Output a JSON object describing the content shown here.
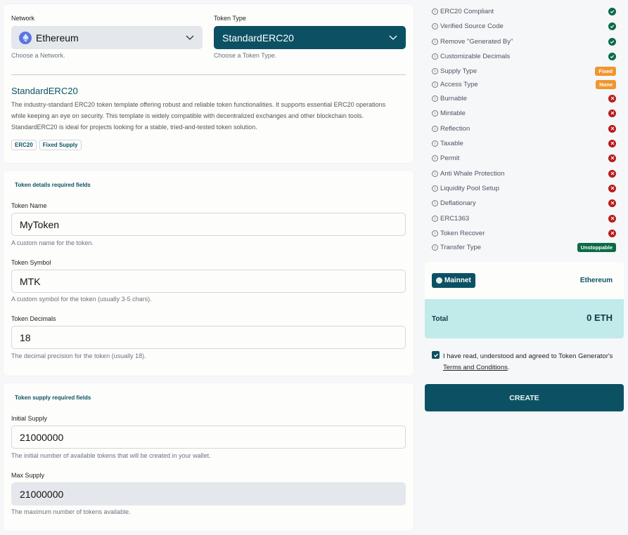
{
  "network": {
    "label": "Network",
    "value": "Ethereum",
    "help": "Choose a Network."
  },
  "token_type": {
    "label": "Token Type",
    "value": "StandardERC20",
    "help": "Choose a Token Type."
  },
  "template": {
    "title": "StandardERC20",
    "description": "The industry-standard ERC20 token template offering robust and reliable token functionalities. It supports essential ERC20 operations while keeping an eye on security. This template is widely compatible with decentralized exchanges and other blockchain tools. StandardERC20 is ideal for projects looking for a stable, tried-and-tested token solution.",
    "tags": [
      "ERC20",
      "Fixed Supply"
    ]
  },
  "details": {
    "title": "Token details required fields",
    "fields": [
      {
        "label": "Token Name",
        "value": "MyToken",
        "help": "A custom name for the token."
      },
      {
        "label": "Token Symbol",
        "value": "MTK",
        "help": "A custom symbol for the token (usually 3-5 chars)."
      },
      {
        "label": "Token Decimals",
        "value": "18",
        "help": "The decimal precision for the token (usually 18)."
      }
    ]
  },
  "supply": {
    "title": "Token supply required fields",
    "fields": [
      {
        "label": "Initial Supply",
        "value": "21000000",
        "help": "The initial number of available tokens that will be created in your wallet."
      },
      {
        "label": "Max Supply",
        "value": "21000000",
        "help": "The maximum number of tokens available."
      }
    ]
  },
  "features": [
    {
      "name": "ERC20 Compliant",
      "status": "yes"
    },
    {
      "name": "Verified Source Code",
      "status": "yes"
    },
    {
      "name": "Remove \"Generated By\"",
      "status": "yes"
    },
    {
      "name": "Customizable Decimals",
      "status": "yes"
    },
    {
      "name": "Supply Type",
      "status": "pill",
      "pill": "Fixed",
      "color": "#f0962f"
    },
    {
      "name": "Access Type",
      "status": "pill",
      "pill": "None",
      "color": "#f0962f"
    },
    {
      "name": "Burnable",
      "status": "no"
    },
    {
      "name": "Mintable",
      "status": "no"
    },
    {
      "name": "Reflection",
      "status": "no"
    },
    {
      "name": "Taxable",
      "status": "no"
    },
    {
      "name": "Permit",
      "status": "no"
    },
    {
      "name": "Anti Whale Protection",
      "status": "no"
    },
    {
      "name": "Liquidity Pool Setup",
      "status": "no"
    },
    {
      "name": "Deflationary",
      "status": "no"
    },
    {
      "name": "ERC1363",
      "status": "no"
    },
    {
      "name": "Token Recover",
      "status": "no"
    },
    {
      "name": "Transfer Type",
      "status": "pill",
      "pill": "Unstoppable",
      "color": "#0a6b47"
    }
  ],
  "summary": {
    "network_badge": "Mainnet",
    "network_name": "Ethereum",
    "total_label": "Total",
    "total_value": "0 ETH"
  },
  "agreement": {
    "checked": true,
    "text": "I have read, understood and agreed to Token Generator's",
    "link": "Terms and Conditions",
    "suffix": "."
  },
  "create_button": "CREATE",
  "colors": {
    "primary": "#0c5163",
    "success": "#0a6b47",
    "danger": "#b91c1c",
    "warning": "#f0962f",
    "total_bg": "#c1eaea"
  }
}
